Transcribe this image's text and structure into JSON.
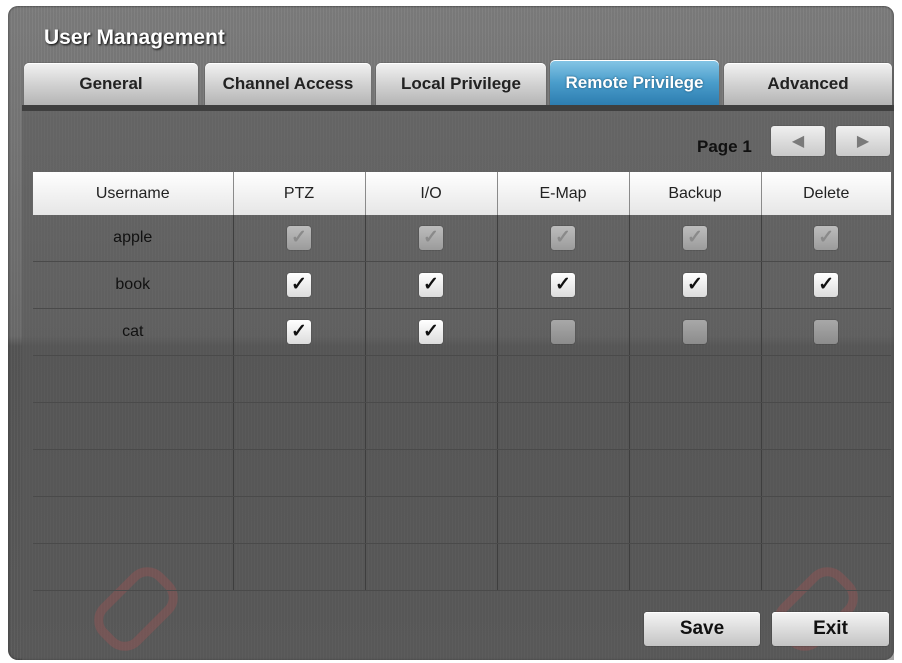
{
  "window": {
    "title": "User Management"
  },
  "tabs": [
    {
      "label": "General",
      "active": false
    },
    {
      "label": "Channel Access",
      "active": false
    },
    {
      "label": "Local Privilege",
      "active": false
    },
    {
      "label": "Remote Privilege",
      "active": true
    },
    {
      "label": "Advanced",
      "active": false
    }
  ],
  "pager": {
    "label": "Page 1",
    "prev_icon": "left-triangle-icon",
    "next_icon": "right-triangle-icon"
  },
  "table": {
    "headers": [
      "Username",
      "PTZ",
      "I/O",
      "E-Map",
      "Backup",
      "Delete"
    ],
    "rows": [
      {
        "username": "apple",
        "state": "disabled-checked",
        "ptz": true,
        "io": true,
        "emap": true,
        "backup": true,
        "delete": true
      },
      {
        "username": "book",
        "state": "enabled",
        "ptz": true,
        "io": true,
        "emap": true,
        "backup": true,
        "delete": true
      },
      {
        "username": "cat",
        "state": "enabled",
        "ptz": true,
        "io": true,
        "emap": false,
        "backup": false,
        "delete": false
      }
    ],
    "empty_rows": 5
  },
  "buttons": {
    "save": "Save",
    "exit": "Exit"
  },
  "colors": {
    "active_tab": "#4a9dcb",
    "panel": "#666666"
  }
}
